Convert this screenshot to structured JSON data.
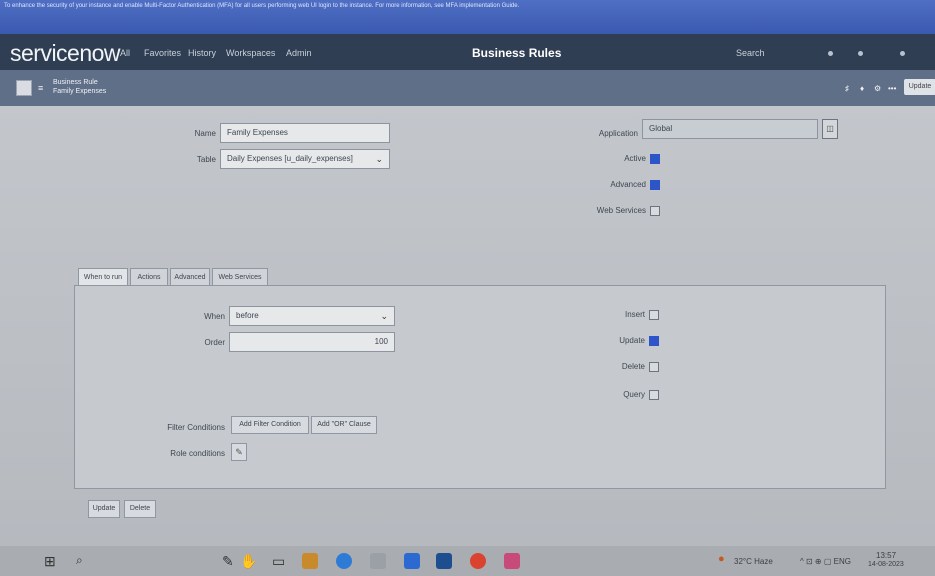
{
  "banner": {
    "text": "To enhance the security of your instance and enable Multi-Factor Authentication (MFA) for all users performing web UI login to the instance. For more information, see MFA implementation Guide."
  },
  "nav": {
    "logo": "servicenow",
    "links": [
      "All",
      "Favorites",
      "History",
      "Workspaces",
      "Admin"
    ],
    "page_heading": "Business Rules",
    "search_label": "Search"
  },
  "formbar": {
    "record_type": "Business Rule",
    "record_name": "Family Expenses",
    "update_label": "Update"
  },
  "form": {
    "name_label": "Name",
    "name_value": "Family Expenses",
    "table_label": "Table",
    "table_value": "Daily Expenses [u_daily_expenses]",
    "application_label": "Application",
    "application_value": "Global",
    "active_label": "Active",
    "advanced_label": "Advanced",
    "web_services_label": "Web Services",
    "active": true,
    "advanced": true,
    "web_services": false
  },
  "tabs": [
    "When to run",
    "Actions",
    "Advanced",
    "Web Services"
  ],
  "when_to_run": {
    "when_label": "When",
    "when_value": "before",
    "order_label": "Order",
    "order_value": "100",
    "insert_label": "Insert",
    "update_label": "Update",
    "delete_label": "Delete",
    "query_label": "Query",
    "insert": false,
    "update": true,
    "delete": false,
    "query": false,
    "filter_label": "Filter Conditions",
    "add_filter_btn": "Add Filter Condition",
    "add_or_btn": "Add \"OR\" Clause",
    "role_label": "Role conditions"
  },
  "bottom_buttons": [
    "Update",
    "Delete"
  ],
  "taskbar": {
    "weather": "32°C Haze",
    "time": "13:57",
    "date": "14-08-2023"
  }
}
